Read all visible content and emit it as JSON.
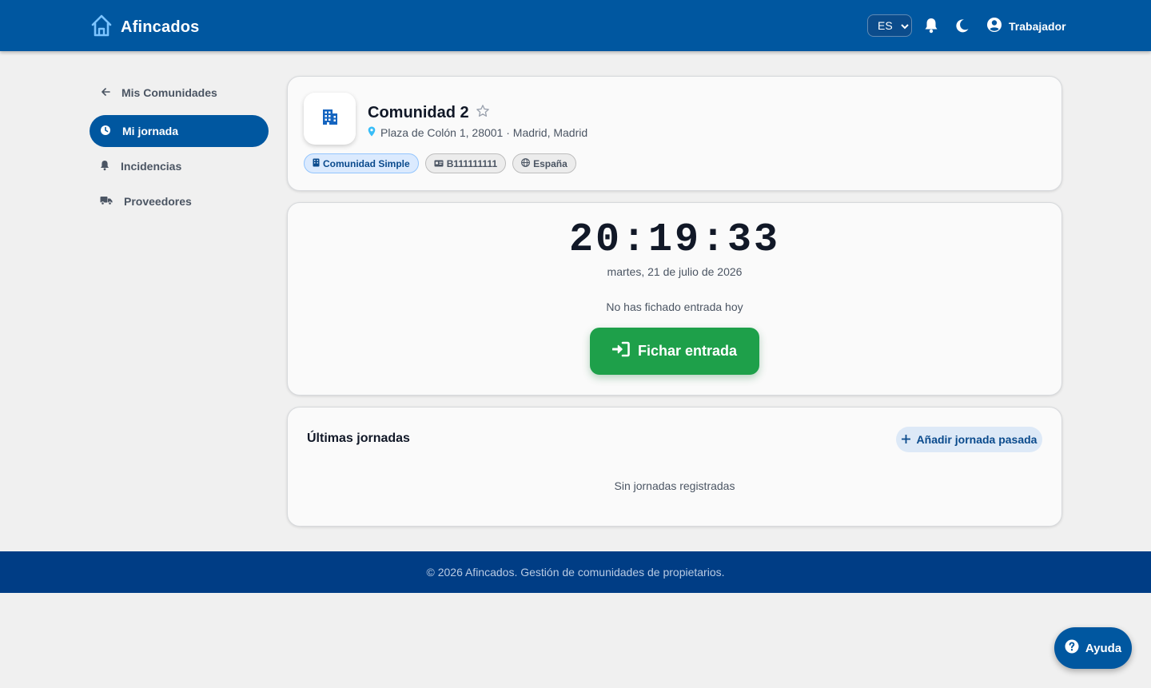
{
  "app": {
    "name": "Afincados"
  },
  "header": {
    "language": "ES",
    "user_label": "Trabajador",
    "icons": [
      "home-icon",
      "bell-icon",
      "moon-icon",
      "account-circle-icon"
    ]
  },
  "sidebar": {
    "back_label": "Mis Comunidades",
    "items": [
      {
        "label": "Mi jornada",
        "icon": "clock-icon",
        "active": true
      },
      {
        "label": "Incidencias",
        "icon": "bell-icon",
        "active": false
      },
      {
        "label": "Proveedores",
        "icon": "truck-icon",
        "active": false
      }
    ]
  },
  "community": {
    "name": "Comunidad 2",
    "address": "Plaza de Colón 1, 28001 · Madrid, Madrid",
    "chips": [
      {
        "label": "Comunidad Simple",
        "icon": "building-icon"
      },
      {
        "label": "B111111111",
        "icon": "id-card-icon"
      },
      {
        "label": "España",
        "icon": "globe-icon"
      }
    ]
  },
  "clock": {
    "time": "20:19:33",
    "date": "martes, 21 de julio de 2026",
    "status": "No has fichado entrada hoy",
    "checkin_label": "Fichar entrada"
  },
  "history": {
    "title": "Últimas jornadas",
    "add_label": "Añadir jornada pasada",
    "empty_text": "Sin jornadas registradas"
  },
  "footer": {
    "text": "© 2026 Afincados. Gestión de comunidades de propietarios."
  },
  "help": {
    "label": "Ayuda"
  },
  "colors": {
    "primary": "#0057a0",
    "footer": "#003d85",
    "success": "#1ea04a",
    "chip_primary_bg": "#dbeafe",
    "background": "#f0f0f0"
  }
}
